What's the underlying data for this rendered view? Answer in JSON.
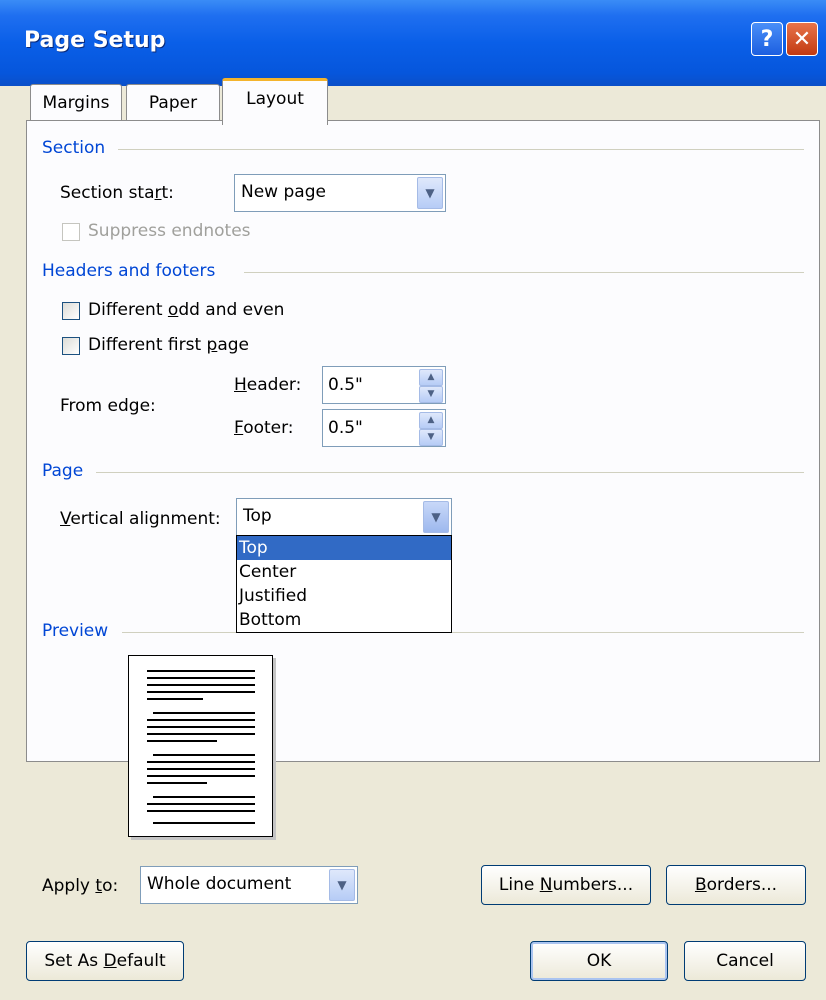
{
  "window": {
    "title": "Page Setup",
    "help_glyph": "?",
    "close_glyph": "✕"
  },
  "tabs": [
    {
      "label": "Margins"
    },
    {
      "label": "Paper"
    },
    {
      "label": "Layout",
      "active": true
    }
  ],
  "section": {
    "heading": "Section",
    "start_label": "Section start:",
    "start_value": "New page",
    "suppress_label": "Suppress endnotes"
  },
  "headers_footers": {
    "heading": "Headers and footers",
    "odd_even_label": "Different odd and even",
    "first_page_label": "Different first page",
    "from_edge_label": "From edge:",
    "header_label": "Header:",
    "header_value": "0.5\"",
    "footer_label": "Footer:",
    "footer_value": "0.5\""
  },
  "page": {
    "heading": "Page",
    "valign_label": "Vertical alignment:",
    "valign_value": "Top",
    "valign_options": [
      "Top",
      "Center",
      "Justified",
      "Bottom"
    ]
  },
  "preview": {
    "heading": "Preview"
  },
  "apply": {
    "label": "Apply to:",
    "value": "Whole document",
    "line_numbers_label": "Line Numbers...",
    "borders_label": "Borders..."
  },
  "footer": {
    "default_label": "Set As Default",
    "ok_label": "OK",
    "cancel_label": "Cancel"
  },
  "colors": {
    "title_bar": "#0a5fe8",
    "group_heading": "#0046d5",
    "selection": "#316ac5"
  }
}
